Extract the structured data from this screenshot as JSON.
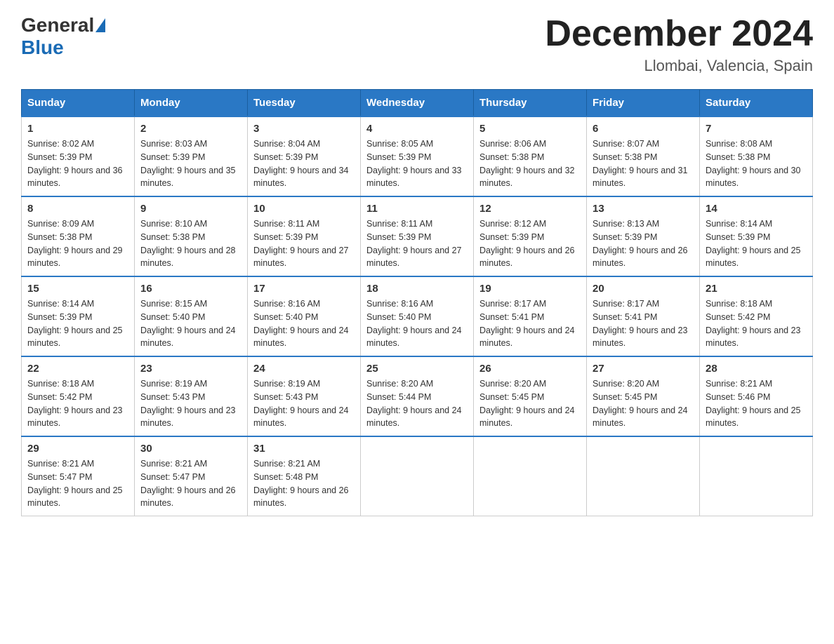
{
  "header": {
    "logo_general": "General",
    "logo_blue": "Blue",
    "month_title": "December 2024",
    "location": "Llombai, Valencia, Spain"
  },
  "days_of_week": [
    "Sunday",
    "Monday",
    "Tuesday",
    "Wednesday",
    "Thursday",
    "Friday",
    "Saturday"
  ],
  "weeks": [
    [
      {
        "day": "1",
        "sunrise": "8:02 AM",
        "sunset": "5:39 PM",
        "daylight": "9 hours and 36 minutes."
      },
      {
        "day": "2",
        "sunrise": "8:03 AM",
        "sunset": "5:39 PM",
        "daylight": "9 hours and 35 minutes."
      },
      {
        "day": "3",
        "sunrise": "8:04 AM",
        "sunset": "5:39 PM",
        "daylight": "9 hours and 34 minutes."
      },
      {
        "day": "4",
        "sunrise": "8:05 AM",
        "sunset": "5:39 PM",
        "daylight": "9 hours and 33 minutes."
      },
      {
        "day": "5",
        "sunrise": "8:06 AM",
        "sunset": "5:38 PM",
        "daylight": "9 hours and 32 minutes."
      },
      {
        "day": "6",
        "sunrise": "8:07 AM",
        "sunset": "5:38 PM",
        "daylight": "9 hours and 31 minutes."
      },
      {
        "day": "7",
        "sunrise": "8:08 AM",
        "sunset": "5:38 PM",
        "daylight": "9 hours and 30 minutes."
      }
    ],
    [
      {
        "day": "8",
        "sunrise": "8:09 AM",
        "sunset": "5:38 PM",
        "daylight": "9 hours and 29 minutes."
      },
      {
        "day": "9",
        "sunrise": "8:10 AM",
        "sunset": "5:38 PM",
        "daylight": "9 hours and 28 minutes."
      },
      {
        "day": "10",
        "sunrise": "8:11 AM",
        "sunset": "5:39 PM",
        "daylight": "9 hours and 27 minutes."
      },
      {
        "day": "11",
        "sunrise": "8:11 AM",
        "sunset": "5:39 PM",
        "daylight": "9 hours and 27 minutes."
      },
      {
        "day": "12",
        "sunrise": "8:12 AM",
        "sunset": "5:39 PM",
        "daylight": "9 hours and 26 minutes."
      },
      {
        "day": "13",
        "sunrise": "8:13 AM",
        "sunset": "5:39 PM",
        "daylight": "9 hours and 26 minutes."
      },
      {
        "day": "14",
        "sunrise": "8:14 AM",
        "sunset": "5:39 PM",
        "daylight": "9 hours and 25 minutes."
      }
    ],
    [
      {
        "day": "15",
        "sunrise": "8:14 AM",
        "sunset": "5:39 PM",
        "daylight": "9 hours and 25 minutes."
      },
      {
        "day": "16",
        "sunrise": "8:15 AM",
        "sunset": "5:40 PM",
        "daylight": "9 hours and 24 minutes."
      },
      {
        "day": "17",
        "sunrise": "8:16 AM",
        "sunset": "5:40 PM",
        "daylight": "9 hours and 24 minutes."
      },
      {
        "day": "18",
        "sunrise": "8:16 AM",
        "sunset": "5:40 PM",
        "daylight": "9 hours and 24 minutes."
      },
      {
        "day": "19",
        "sunrise": "8:17 AM",
        "sunset": "5:41 PM",
        "daylight": "9 hours and 24 minutes."
      },
      {
        "day": "20",
        "sunrise": "8:17 AM",
        "sunset": "5:41 PM",
        "daylight": "9 hours and 23 minutes."
      },
      {
        "day": "21",
        "sunrise": "8:18 AM",
        "sunset": "5:42 PM",
        "daylight": "9 hours and 23 minutes."
      }
    ],
    [
      {
        "day": "22",
        "sunrise": "8:18 AM",
        "sunset": "5:42 PM",
        "daylight": "9 hours and 23 minutes."
      },
      {
        "day": "23",
        "sunrise": "8:19 AM",
        "sunset": "5:43 PM",
        "daylight": "9 hours and 23 minutes."
      },
      {
        "day": "24",
        "sunrise": "8:19 AM",
        "sunset": "5:43 PM",
        "daylight": "9 hours and 24 minutes."
      },
      {
        "day": "25",
        "sunrise": "8:20 AM",
        "sunset": "5:44 PM",
        "daylight": "9 hours and 24 minutes."
      },
      {
        "day": "26",
        "sunrise": "8:20 AM",
        "sunset": "5:45 PM",
        "daylight": "9 hours and 24 minutes."
      },
      {
        "day": "27",
        "sunrise": "8:20 AM",
        "sunset": "5:45 PM",
        "daylight": "9 hours and 24 minutes."
      },
      {
        "day": "28",
        "sunrise": "8:21 AM",
        "sunset": "5:46 PM",
        "daylight": "9 hours and 25 minutes."
      }
    ],
    [
      {
        "day": "29",
        "sunrise": "8:21 AM",
        "sunset": "5:47 PM",
        "daylight": "9 hours and 25 minutes."
      },
      {
        "day": "30",
        "sunrise": "8:21 AM",
        "sunset": "5:47 PM",
        "daylight": "9 hours and 26 minutes."
      },
      {
        "day": "31",
        "sunrise": "8:21 AM",
        "sunset": "5:48 PM",
        "daylight": "9 hours and 26 minutes."
      },
      null,
      null,
      null,
      null
    ]
  ]
}
